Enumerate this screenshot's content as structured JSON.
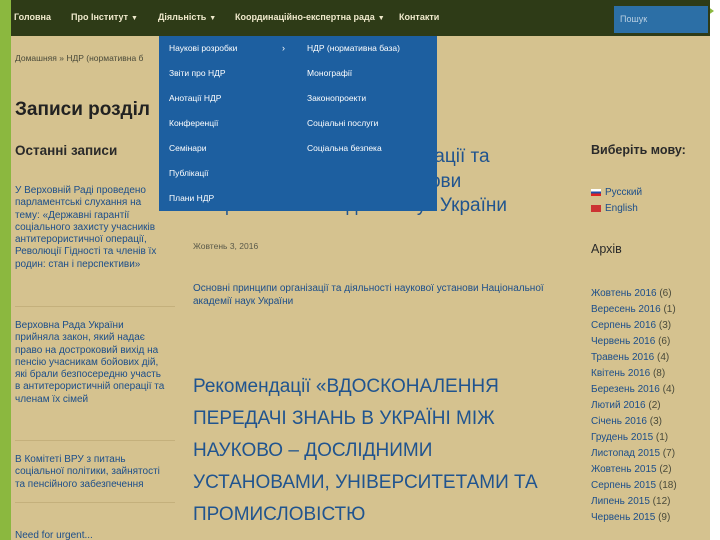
{
  "nav": {
    "items": [
      "Головна",
      "Про Інститут",
      "Діяльність",
      "Координаційно-експертна рада",
      "Контакти"
    ],
    "search_placeholder": "Пошук"
  },
  "breadcrumb": "Домашняя » НДР (нормативна б",
  "page_title": "Записи розділ",
  "dropdown": {
    "left": [
      "Наукові розробки",
      "Звіти про НДР",
      "Анотації НДР",
      "Конференції",
      "Семінари",
      "Публікації",
      "Плани НДР"
    ],
    "right": [
      "НДР (нормативна база)",
      "Монографії",
      "Законопроекти",
      "Соціальні послуги",
      "Соціальна безпека"
    ]
  },
  "sidebar_left": {
    "heading": "Останні записи",
    "posts": [
      [
        "У Верховній Раді проведено",
        "парламентські слухання на",
        "тему: «Державні гарантії",
        "соціального захисту учасників",
        "антитерористичної операції,",
        "Революції Гідності та членів їх",
        "родин: стан і перспективи»"
      ],
      [
        "Верховна Рада України",
        "прийняла закон, який надає",
        "право на достроковий вихід на",
        "пенсію учасникам бойових дій,",
        "які брали безпосередню участь",
        "в антитерористичній операції та",
        "членам їх сімей"
      ],
      [
        "В Комітеті ВРУ з питань",
        "соціальної політики, зайнятості",
        "та пенсійного забезпечення"
      ],
      [
        "Need for urgent..."
      ]
    ]
  },
  "main": {
    "post1": {
      "title_lines": [
        "принципи організації та",
        "ті наукової установи",
        "Національної академії наук України"
      ],
      "date": "Жовтень 3, 2016",
      "excerpt_lines": [
        "Основні принципи організації та діяльності наукової установи Національної",
        "академії наук України"
      ]
    },
    "post2": {
      "title_lines": [
        "Рекомендації «ВДОСКОНАЛЕННЯ",
        "ПЕРЕДАЧІ ЗНАНЬ В УКРАЇНІ МІЖ",
        "НАУКОВО – ДОСЛІДНИМИ",
        "УСТАНОВАМИ, УНІВЕРСИТЕТАМИ ТА",
        "ПРОМИСЛОВІСТЮ"
      ]
    }
  },
  "sidebar_right": {
    "lang_heading": "Виберіть мову:",
    "languages": [
      "Русский",
      "English"
    ],
    "archive_heading": "Архів",
    "archive": [
      [
        "Жовтень 2016",
        "(6)"
      ],
      [
        "Вересень 2016",
        "(1)"
      ],
      [
        "Серпень 2016",
        "(3)"
      ],
      [
        "Червень 2016",
        "(6)"
      ],
      [
        "Травень 2016",
        "(4)"
      ],
      [
        "Квітень 2016",
        "(8)"
      ],
      [
        "Березень 2016",
        "(4)"
      ],
      [
        "Лютий 2016",
        "(2)"
      ],
      [
        "Січень 2016",
        "(3)"
      ],
      [
        "Грудень 2015",
        "(1)"
      ],
      [
        "Листопад 2015",
        "(7)"
      ],
      [
        "Жовтень 2015",
        "(2)"
      ],
      [
        "Серпень 2015",
        "(18)"
      ],
      [
        "Липень 2015",
        "(12)"
      ],
      [
        "Червень 2015",
        "(9)"
      ]
    ]
  },
  "colors": {
    "accent_green": "#8bb83f",
    "nav_bg": "#2e3b17",
    "dropdown_bg": "#1d5fa0",
    "link": "#1c4e8a",
    "page_bg": "#d5c28f"
  }
}
